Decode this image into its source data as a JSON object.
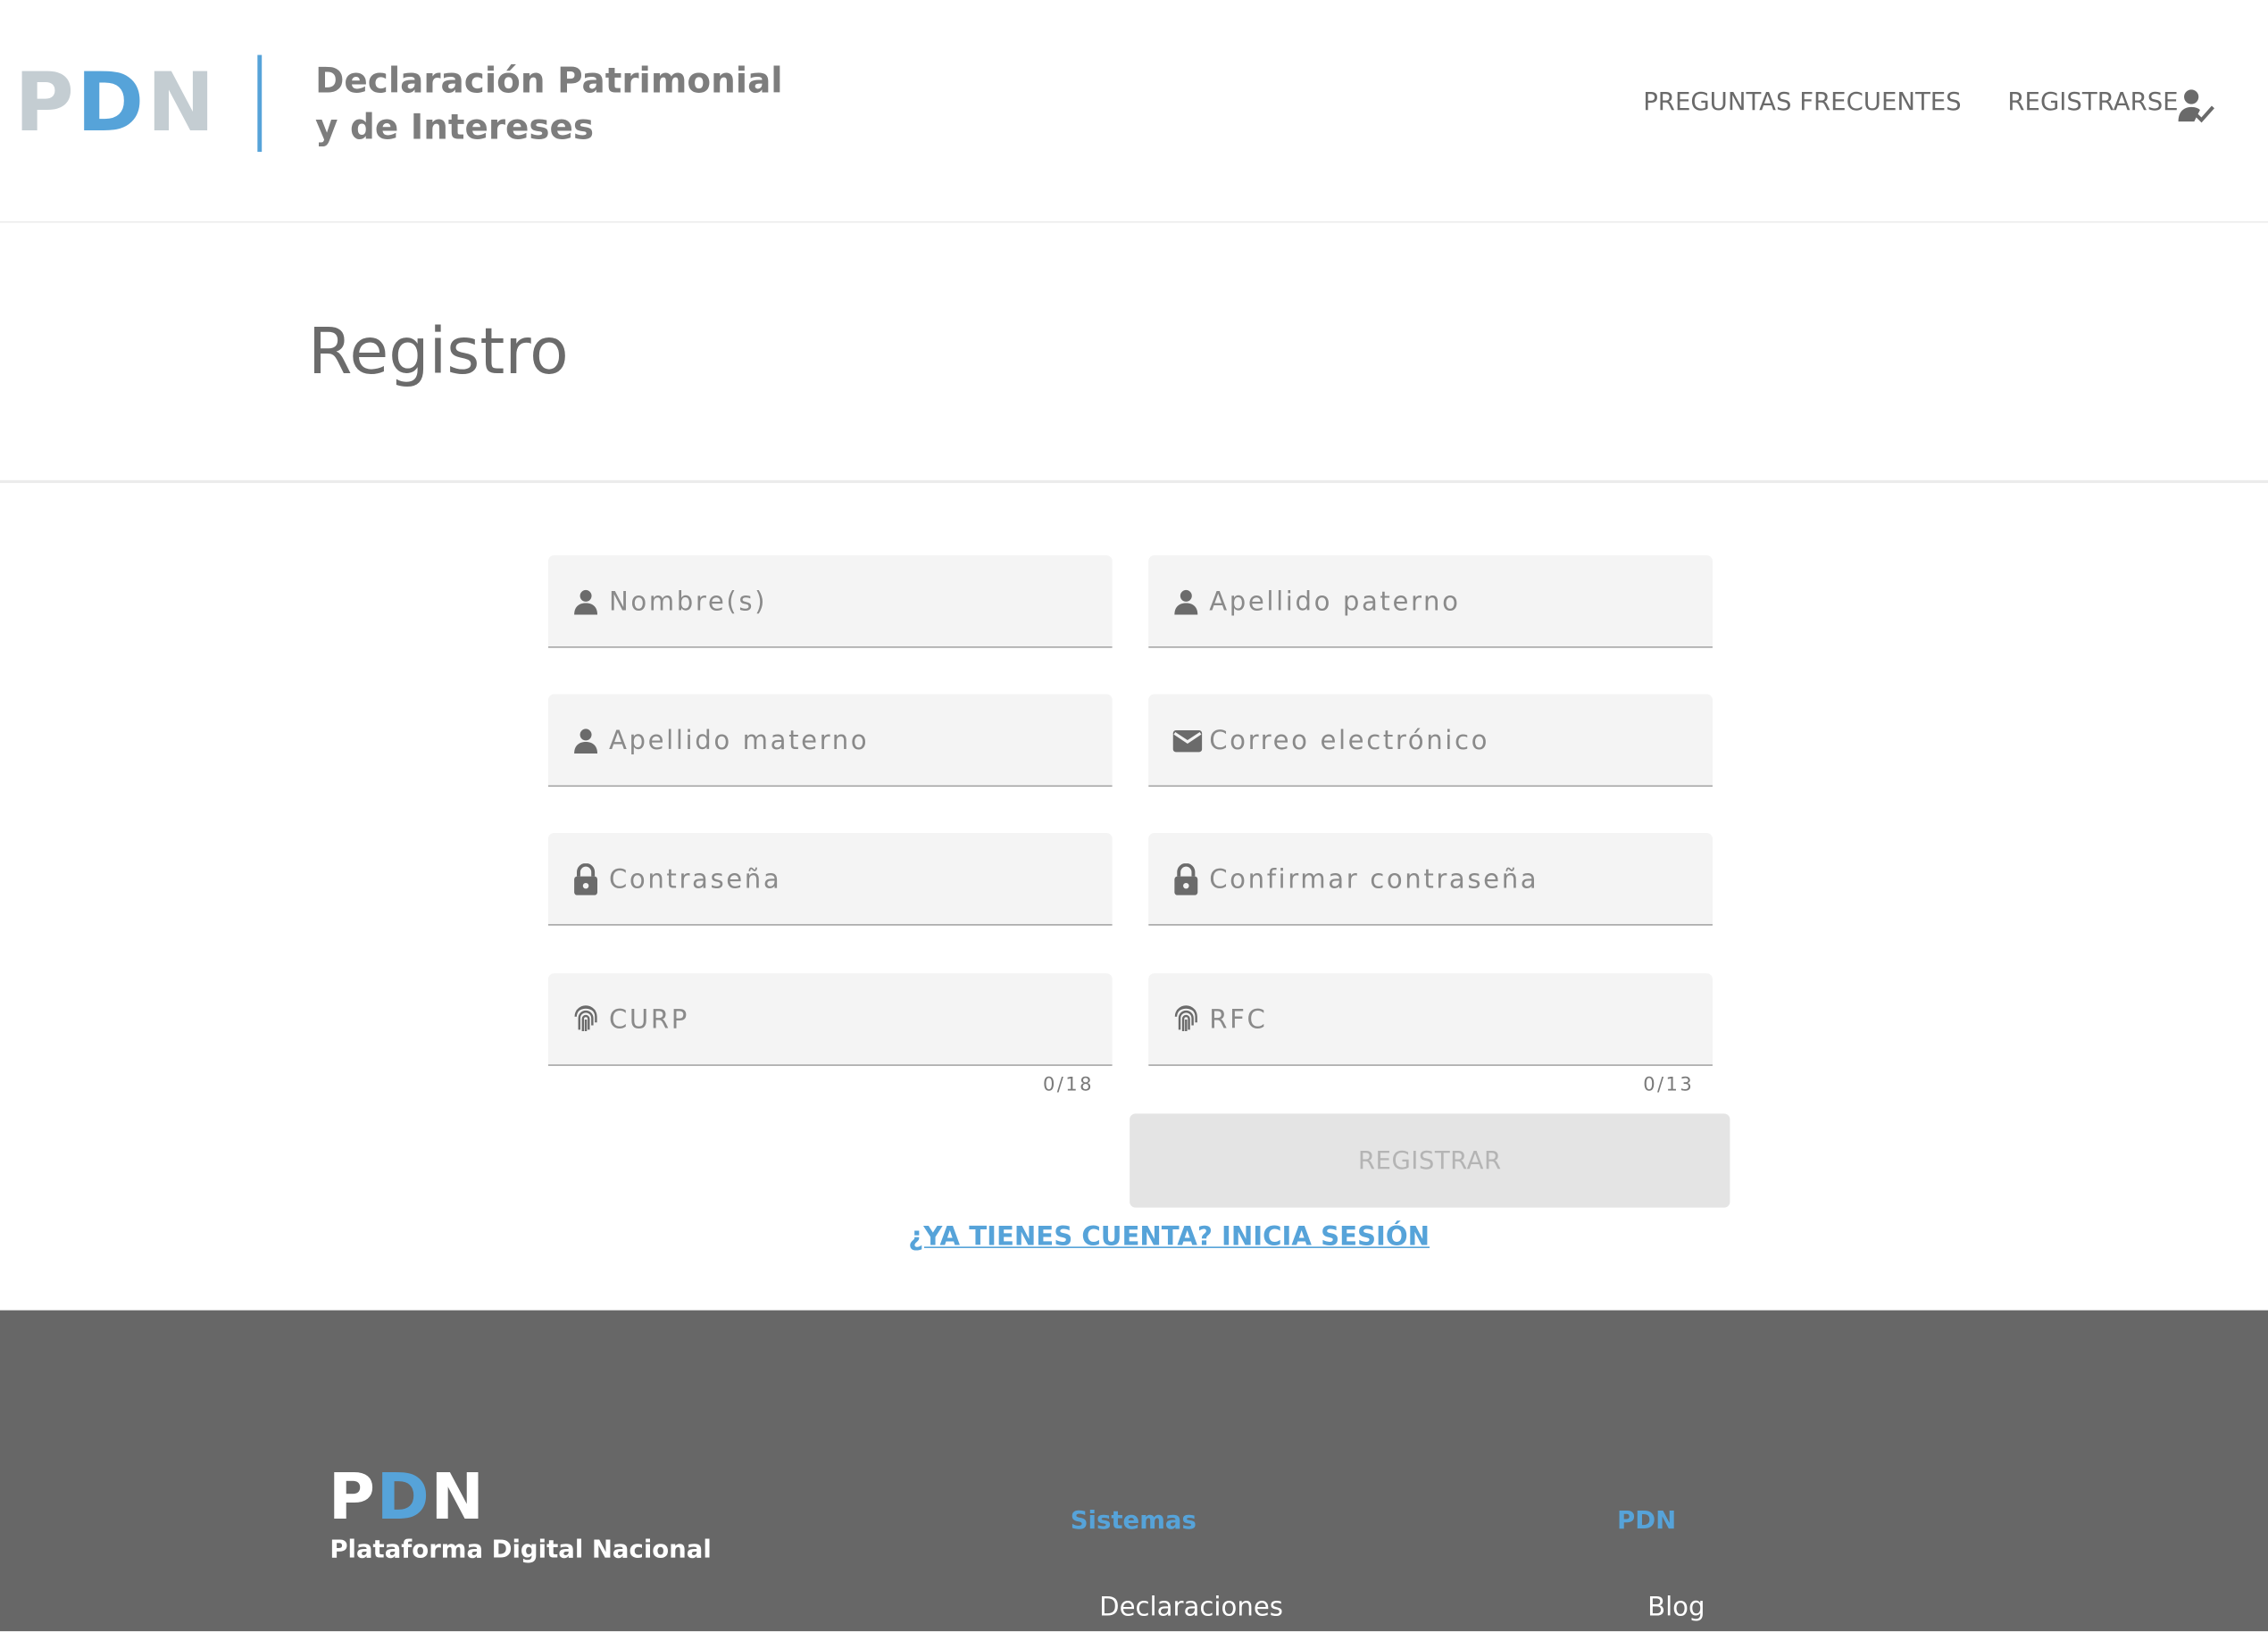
{
  "header": {
    "logo": {
      "p": "P",
      "d": "D",
      "n": "N"
    },
    "title_line1": "Declaración Patrimonial",
    "title_line2": "y de Intereses",
    "nav": {
      "faq": "PREGUNTAS FRECUENTES",
      "register": "REGISTRARSE",
      "register_icon": "person-check-icon"
    }
  },
  "page": {
    "title": "Registro"
  },
  "form": {
    "fields": {
      "nombre": {
        "placeholder": "Nombre(s)",
        "icon": "person-icon",
        "value": ""
      },
      "apellido_paterno": {
        "placeholder": "Apellido paterno",
        "icon": "person-icon",
        "value": ""
      },
      "apellido_materno": {
        "placeholder": "Apellido materno",
        "icon": "person-icon",
        "value": ""
      },
      "correo": {
        "placeholder": "Correo electrónico",
        "icon": "mail-icon",
        "value": ""
      },
      "contrasena": {
        "placeholder": "Contraseña",
        "icon": "lock-icon",
        "value": ""
      },
      "confirmar": {
        "placeholder": "Confirmar contraseña",
        "icon": "lock-icon",
        "value": ""
      },
      "curp": {
        "placeholder": "CURP",
        "icon": "fingerprint-icon",
        "value": "",
        "counter": "0/18"
      },
      "rfc": {
        "placeholder": "RFC",
        "icon": "fingerprint-icon",
        "value": "",
        "counter": "0/13"
      }
    },
    "submit_label": "REGISTRAR",
    "submit_disabled": true,
    "login_link": "¿YA TIENES CUENTA? INICIA SESIÓN"
  },
  "footer": {
    "logo": {
      "p": "P",
      "d": "D",
      "n": "N"
    },
    "subtitle": "Plataforma Digital Nacional",
    "columns": [
      {
        "heading": "Sistemas",
        "items": [
          "Declaraciones"
        ]
      },
      {
        "heading": "PDN",
        "items": [
          "Blog"
        ]
      }
    ]
  },
  "colors": {
    "accent": "#56a3d9",
    "text_gray": "#6b6b6b",
    "footer_bg": "#676767",
    "field_bg": "#f4f4f4"
  }
}
